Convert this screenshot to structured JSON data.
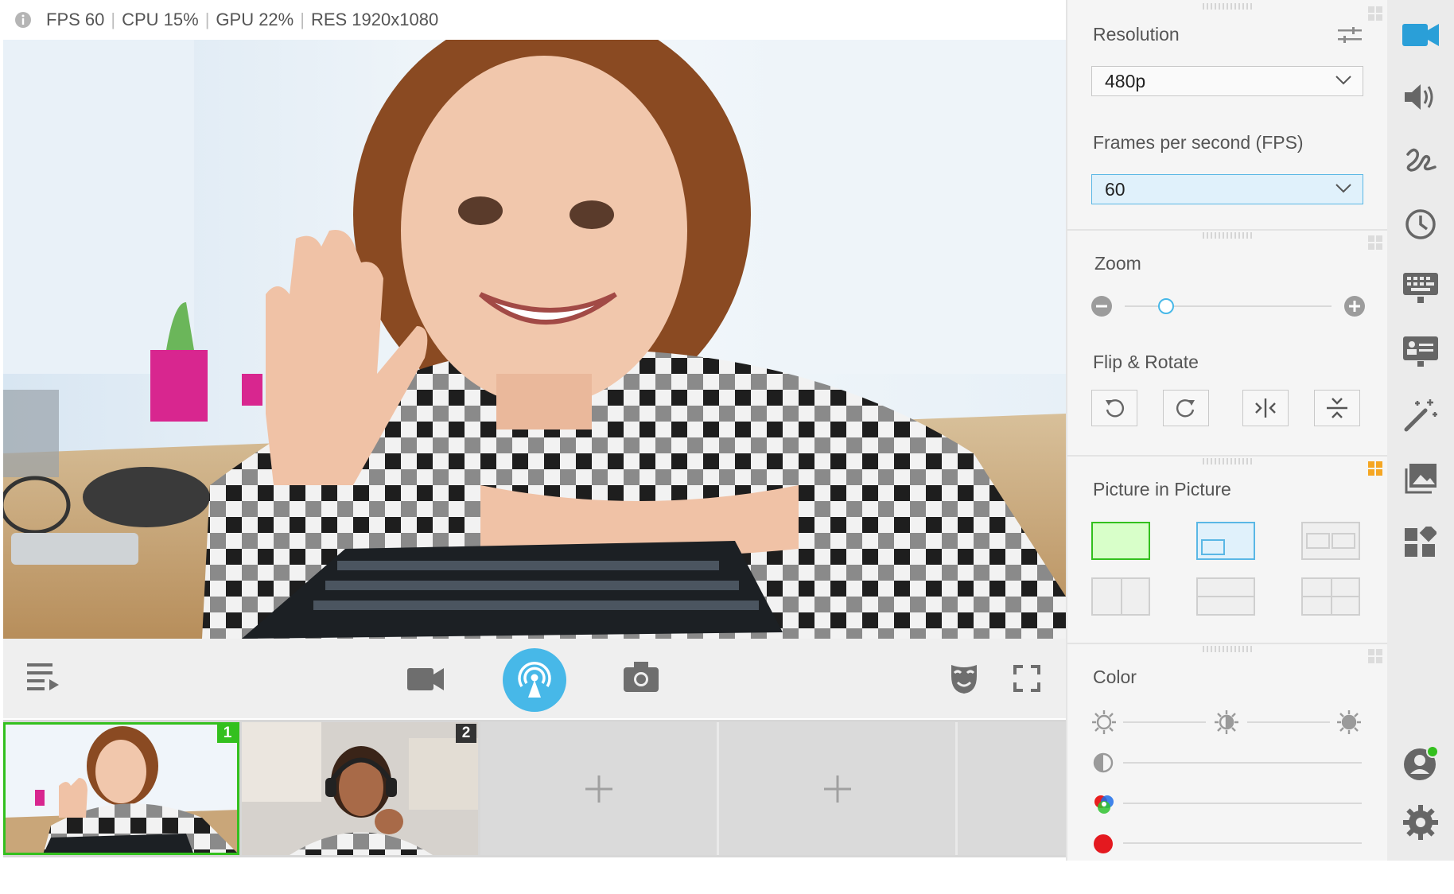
{
  "status_bar": {
    "fps": "FPS 60",
    "cpu": "CPU 15%",
    "gpu": "GPU 22%",
    "res": "RES 1920x1080",
    "separator": "|"
  },
  "thumbnails": [
    {
      "number": "1",
      "selected": true
    },
    {
      "number": "2",
      "selected": false
    }
  ],
  "panel": {
    "resolution": {
      "title": "Resolution",
      "value": "480p"
    },
    "fps": {
      "title": "Frames per second (FPS)",
      "value": "60"
    },
    "zoom": {
      "title": "Zoom",
      "level": 0.2
    },
    "flip_rotate": {
      "title": "Flip & Rotate"
    },
    "pip": {
      "title": "Picture in Picture"
    },
    "color": {
      "title": "Color"
    }
  },
  "colors": {
    "accent_blue": "#47b8e8",
    "selected_green": "#33c01e",
    "online_green": "#33c01e",
    "nav_active": "#2a9fd8"
  },
  "nav": [
    "camera-icon",
    "speaker-icon",
    "drawing-icon",
    "clock-icon",
    "keyboard-icon",
    "presentation-icon",
    "magic-wand-icon",
    "image-icon",
    "widgets-icon",
    "user-icon",
    "gear-icon"
  ]
}
